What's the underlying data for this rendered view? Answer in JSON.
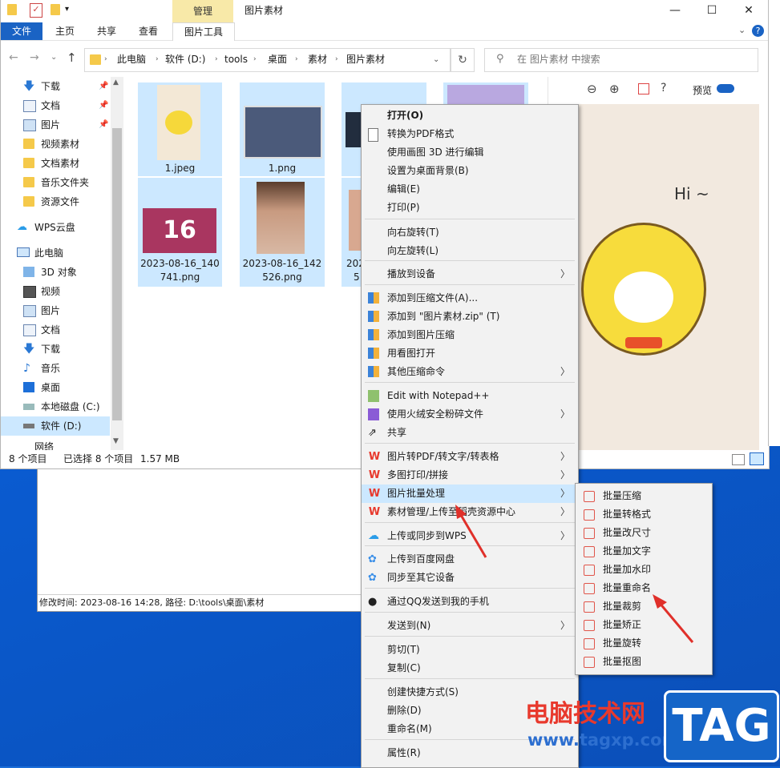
{
  "window": {
    "title": "图片素材",
    "contextual_tab_group": "管理",
    "controls": [
      "—",
      "☐",
      "✕"
    ]
  },
  "ribbon": {
    "file": "文件",
    "tabs": [
      "主页",
      "共享",
      "查看"
    ],
    "contextual_tab": "图片工具"
  },
  "address": {
    "crumbs": [
      "此电脑",
      "软件 (D:)",
      "tools",
      "桌面",
      "素材",
      "图片素材"
    ],
    "search_placeholder": "在 图片素材 中搜索"
  },
  "sidebar": {
    "quick": [
      {
        "label": "下载",
        "pinned": true,
        "icon": "download-icon"
      },
      {
        "label": "文档",
        "pinned": true,
        "icon": "document-icon"
      },
      {
        "label": "图片",
        "pinned": true,
        "icon": "picture-icon"
      },
      {
        "label": "视频素材",
        "pinned": false,
        "icon": "folder-icon"
      },
      {
        "label": "文档素材",
        "pinned": false,
        "icon": "folder-icon"
      },
      {
        "label": "音乐文件夹",
        "pinned": false,
        "icon": "folder-icon"
      },
      {
        "label": "资源文件",
        "pinned": false,
        "icon": "folder-icon"
      }
    ],
    "cloud": "WPS云盘",
    "pc": "此电脑",
    "pc_items": [
      {
        "label": "3D 对象",
        "icon": "cube-icon"
      },
      {
        "label": "视频",
        "icon": "video-icon"
      },
      {
        "label": "图片",
        "icon": "picture-icon"
      },
      {
        "label": "文档",
        "icon": "document-icon"
      },
      {
        "label": "下载",
        "icon": "download-icon"
      },
      {
        "label": "音乐",
        "icon": "music-icon"
      },
      {
        "label": "桌面",
        "icon": "desktop-icon"
      },
      {
        "label": "本地磁盘 (C:)",
        "icon": "drive-icon"
      },
      {
        "label": "软件 (D:)",
        "icon": "drive-icon"
      }
    ],
    "cut_off": "网络"
  },
  "files": [
    {
      "name": "1.jpeg"
    },
    {
      "name": "1.png"
    },
    {
      "name": "2023-08-16_140741.png",
      "line1": "2023-08-16_140",
      "line2": "741.png",
      "thumb_text": "16"
    },
    {
      "name": "2023-08-16_142526.png",
      "line1": "2023-08-16_142",
      "line2": "526.png"
    },
    {
      "name": "20...5...",
      "line1": "202",
      "line2": "5"
    }
  ],
  "status": {
    "count": "8 个项目",
    "selected": "已选择 8 个项目",
    "size": "1.57 MB"
  },
  "preview": {
    "label": "预览",
    "image_text": "Hi ~"
  },
  "bg_window_status": "修改时间: 2023-08-16 14:28, 路径: D:\\tools\\桌面\\素材",
  "context_menu": {
    "items": [
      {
        "label": "打开(O)",
        "bold": true
      },
      {
        "label": "转换为PDF格式"
      },
      {
        "label": "使用画图 3D 进行编辑"
      },
      {
        "label": "设置为桌面背景(B)"
      },
      {
        "label": "编辑(E)"
      },
      {
        "label": "打印(P)"
      },
      {
        "label": "向右旋转(T)"
      },
      {
        "label": "向左旋转(L)"
      },
      {
        "label": "播放到设备",
        "submenu": true
      },
      {
        "label": "添加到压缩文件(A)..."
      },
      {
        "label": "添加到 \"图片素材.zip\" (T)"
      },
      {
        "label": "添加到图片压缩"
      },
      {
        "label": "用看图打开"
      },
      {
        "label": "其他压缩命令",
        "submenu": true
      },
      {
        "label": "Edit with Notepad++"
      },
      {
        "label": "使用火绒安全粉碎文件",
        "submenu": true
      },
      {
        "label": "共享"
      },
      {
        "label": "图片转PDF/转文字/转表格",
        "submenu": true
      },
      {
        "label": "多图打印/拼接",
        "submenu": true
      },
      {
        "label": "图片批量处理",
        "submenu": true,
        "highlighted": true
      },
      {
        "label": "素材管理/上传至稻壳资源中心",
        "submenu": true
      },
      {
        "label": "上传或同步到WPS",
        "submenu": true
      },
      {
        "label": "上传到百度网盘"
      },
      {
        "label": "同步至其它设备"
      },
      {
        "label": "通过QQ发送到我的手机"
      },
      {
        "label": "发送到(N)",
        "submenu": true
      },
      {
        "label": "剪切(T)"
      },
      {
        "label": "复制(C)"
      },
      {
        "label": "创建快捷方式(S)"
      },
      {
        "label": "删除(D)"
      },
      {
        "label": "重命名(M)"
      },
      {
        "label": "属性(R)"
      }
    ]
  },
  "submenu": {
    "items": [
      "批量压缩",
      "批量转格式",
      "批量改尺寸",
      "批量加文字",
      "批量加水印",
      "批量重命名",
      "批量裁剪",
      "批量矫正",
      "批量旋转",
      "批量抠图"
    ]
  },
  "watermark": {
    "cn": "电脑技术网",
    "url": "www.tagxp.com",
    "tag": "TAG"
  },
  "colors": {
    "accent": "#1a63c4",
    "selection": "#cce8ff",
    "wps_red": "#e8392d"
  }
}
